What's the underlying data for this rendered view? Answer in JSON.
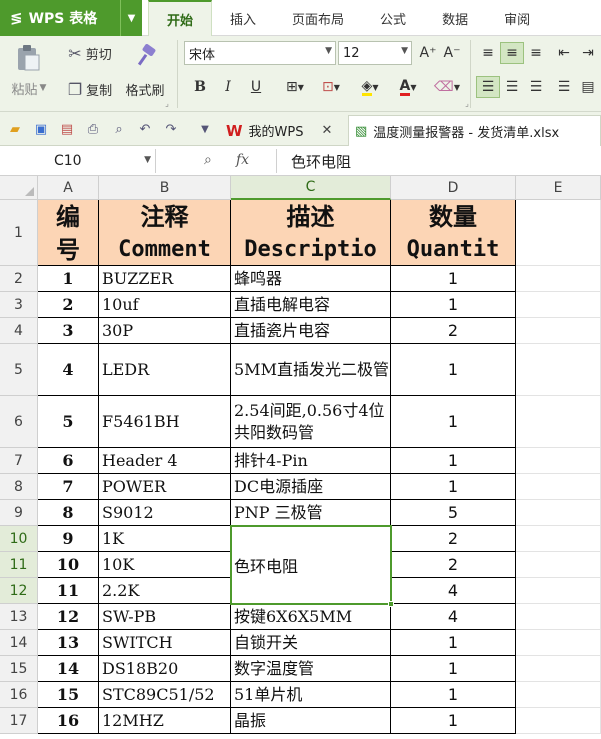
{
  "app": {
    "name": "WPS 表格"
  },
  "menu": {
    "tabs": [
      "开始",
      "插入",
      "页面布局",
      "公式",
      "数据",
      "审阅"
    ],
    "active_index": 0
  },
  "ribbon": {
    "paste": "粘贴",
    "cut": "剪切",
    "copy": "复制",
    "format_painter": "格式刷",
    "font_name": "宋体",
    "font_size": "12",
    "grow_font": "A⁺",
    "shrink_font": "A⁻",
    "bold": "B",
    "italic": "I",
    "underline": "U",
    "font_color_glyph": "A"
  },
  "doc_tabs": [
    {
      "label": "我的WPS"
    },
    {
      "label": "温度测量报警器 - 发货清单.xlsx"
    }
  ],
  "formula_bar": {
    "cell_ref": "C10",
    "fx": "fx",
    "value": "色环电阻"
  },
  "grid": {
    "columns": [
      "A",
      "B",
      "C",
      "D",
      "E"
    ],
    "selected_column": "C",
    "selected_rows": [
      10,
      11,
      12
    ],
    "header": {
      "a": {
        "zh": "编号",
        "line1": "编",
        "line2": "号"
      },
      "b": {
        "zh": "注释",
        "en": "Comment"
      },
      "c": {
        "zh": "描述",
        "en": "Descriptio"
      },
      "d": {
        "zh": "数量",
        "en": "Quantit"
      }
    },
    "rows": [
      {
        "row": "2",
        "no": "1",
        "comment": "BUZZER",
        "desc": "蜂鸣器",
        "qty": "1"
      },
      {
        "row": "3",
        "no": "2",
        "comment": "10uf",
        "desc": "直插电解电容",
        "qty": "1"
      },
      {
        "row": "4",
        "no": "3",
        "comment": "30P",
        "desc": "直插瓷片电容",
        "qty": "2"
      },
      {
        "row": "5",
        "no": "4",
        "comment": "LEDR",
        "desc": "5MM直插发光二极管",
        "qty": "1"
      },
      {
        "row": "6",
        "no": "5",
        "comment": "F5461BH",
        "desc": "2.54间距,0.56寸4位共阳数码管",
        "qty": "1"
      },
      {
        "row": "7",
        "no": "6",
        "comment": "Header 4",
        "desc": "排针4-Pin",
        "qty": "1"
      },
      {
        "row": "8",
        "no": "7",
        "comment": "POWER",
        "desc": "DC电源插座",
        "qty": "1"
      },
      {
        "row": "9",
        "no": "8",
        "comment": "S9012",
        "desc": "PNP 三极管",
        "qty": "5"
      },
      {
        "row": "10",
        "no": "9",
        "comment": "1K",
        "desc": "色环电阻",
        "qty": "2"
      },
      {
        "row": "11",
        "no": "10",
        "comment": "10K",
        "desc": "",
        "qty": "2"
      },
      {
        "row": "12",
        "no": "11",
        "comment": "2.2K",
        "desc": "",
        "qty": "4"
      },
      {
        "row": "13",
        "no": "12",
        "comment": "SW-PB",
        "desc": "按键6X6X5MM",
        "qty": "4"
      },
      {
        "row": "14",
        "no": "13",
        "comment": "SWITCH",
        "desc": "自锁开关",
        "qty": "1"
      },
      {
        "row": "15",
        "no": "14",
        "comment": "DS18B20",
        "desc": "数字温度管",
        "qty": "1"
      },
      {
        "row": "16",
        "no": "15",
        "comment": "STC89C51/52",
        "desc": "51单片机",
        "qty": "1"
      },
      {
        "row": "17",
        "no": "16",
        "comment": "12MHZ",
        "desc": "晶振",
        "qty": "1"
      }
    ],
    "row_headers": [
      "1",
      "2",
      "3",
      "4",
      "5",
      "6",
      "7",
      "8",
      "9",
      "10",
      "11",
      "12",
      "13",
      "14",
      "15",
      "16",
      "17"
    ]
  }
}
